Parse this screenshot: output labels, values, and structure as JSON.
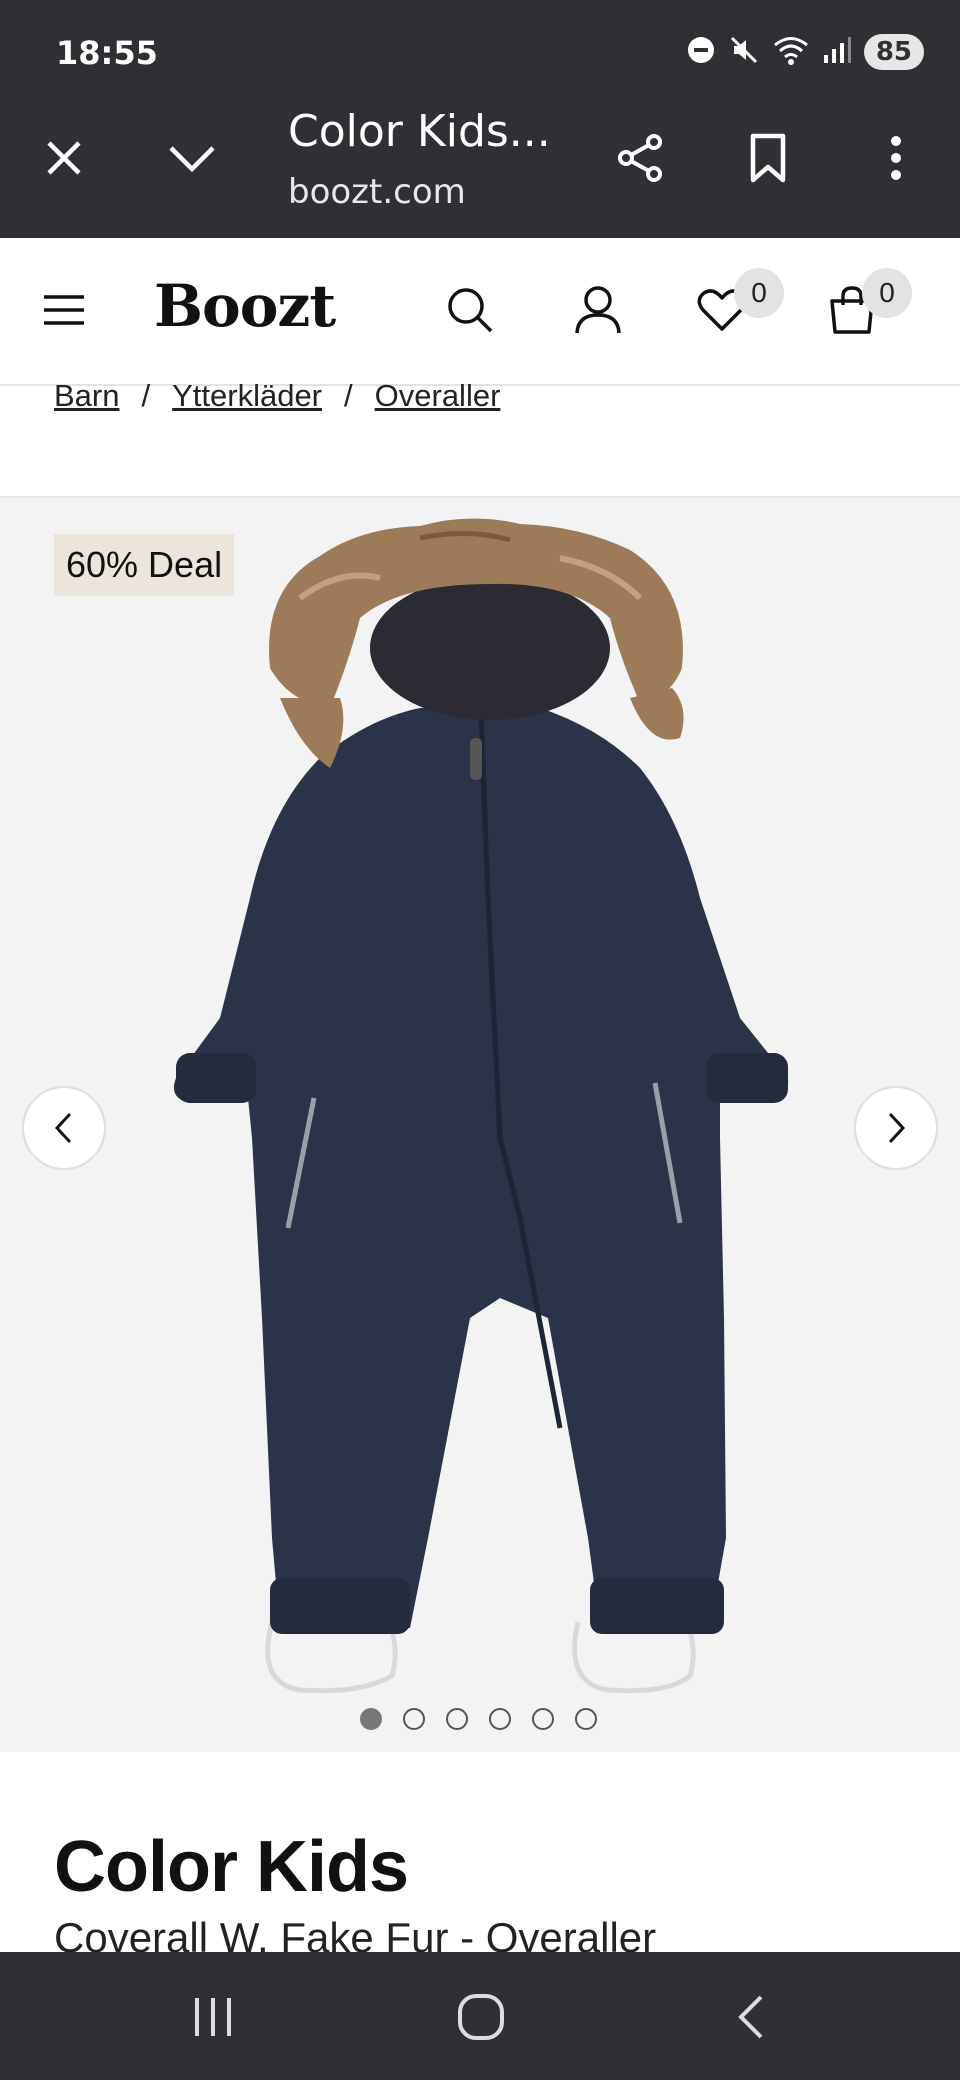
{
  "status_bar": {
    "time": "18:55",
    "battery": "85",
    "icons": [
      "do-not-disturb-icon",
      "mute-icon",
      "wifi-icon",
      "signal-icon"
    ]
  },
  "browser": {
    "tab_title": "Color Kids...",
    "url": "boozt.com",
    "icons": [
      "close-icon",
      "chevron-down-icon",
      "share-icon",
      "bookmark-icon",
      "more-vert-icon"
    ]
  },
  "site_header": {
    "logo": "Boozt",
    "wishlist_count": "0",
    "cart_count": "0",
    "icons": [
      "menu-icon",
      "search-icon",
      "account-icon",
      "heart-icon",
      "bag-icon"
    ]
  },
  "breadcrumb": {
    "items": [
      "Barn",
      "Ytterkläder",
      "Overaller"
    ],
    "separator": "/"
  },
  "gallery": {
    "deal_badge": "60% Deal",
    "image_count": 6,
    "active_index": 0,
    "product_color": "#2a3347",
    "fur_color": "#9d7a58"
  },
  "product": {
    "brand": "Color Kids",
    "name": "Coverall W. Fake Fur - Overaller"
  },
  "nav_bar": {
    "icons": [
      "recent-apps-icon",
      "home-icon",
      "back-icon"
    ]
  }
}
